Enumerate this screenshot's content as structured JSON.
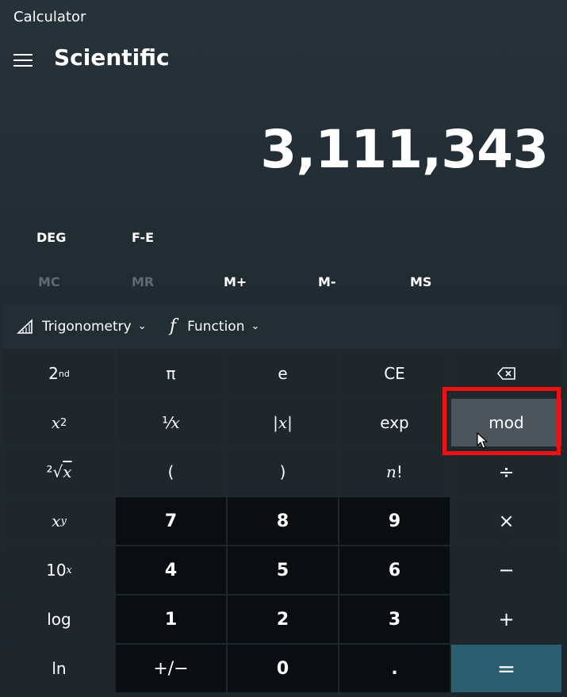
{
  "window": {
    "title": "Calculator"
  },
  "header": {
    "mode_title": "Scientific"
  },
  "display": {
    "value": "3,111,343"
  },
  "angle_row": {
    "angle_unit": "DEG",
    "fe_label": "F-E"
  },
  "memory": {
    "mc": "MC",
    "mr": "MR",
    "mplus": "M+",
    "mminus": "M-",
    "ms": "MS"
  },
  "tools": {
    "trig_label": "Trigonometry",
    "func_label": "Function",
    "func_icon_glyph": "f"
  },
  "keys": {
    "r0": [
      "2",
      "π",
      "e",
      "CE",
      "⌫"
    ],
    "r1": [
      "x²",
      "¹⁄x",
      "|x|",
      "exp",
      "mod"
    ],
    "r2": [
      "²√x",
      "(",
      ")",
      "n!",
      "÷"
    ],
    "r3": [
      "xʸ",
      "7",
      "8",
      "9",
      "×"
    ],
    "r4": [
      "10ˣ",
      "4",
      "5",
      "6",
      "−"
    ],
    "r5": [
      "log",
      "1",
      "2",
      "3",
      "+"
    ],
    "r6": [
      "ln",
      "⁺⁄₋",
      "0",
      ".",
      "="
    ],
    "second_sup": "nd",
    "x2_base": "x",
    "x2_sup": "2",
    "inv_text": "¹⁄",
    "inv_var": "x",
    "abs_text": "|x|",
    "root_prefix": "²√",
    "root_var": "x",
    "fact_var": "n",
    "fact_bang": "!",
    "pow_base": "x",
    "pow_sup": "y",
    "ten_base": "10",
    "ten_sup": "x",
    "plusminus": "+/−"
  },
  "highlight": {
    "target": "mod-key",
    "color": "#f01010"
  },
  "colors": {
    "equals_key": "#2b5e71",
    "hover_key": "#4b555b",
    "numpad_key": "#0b0e11",
    "function_key": "#1f272d"
  }
}
